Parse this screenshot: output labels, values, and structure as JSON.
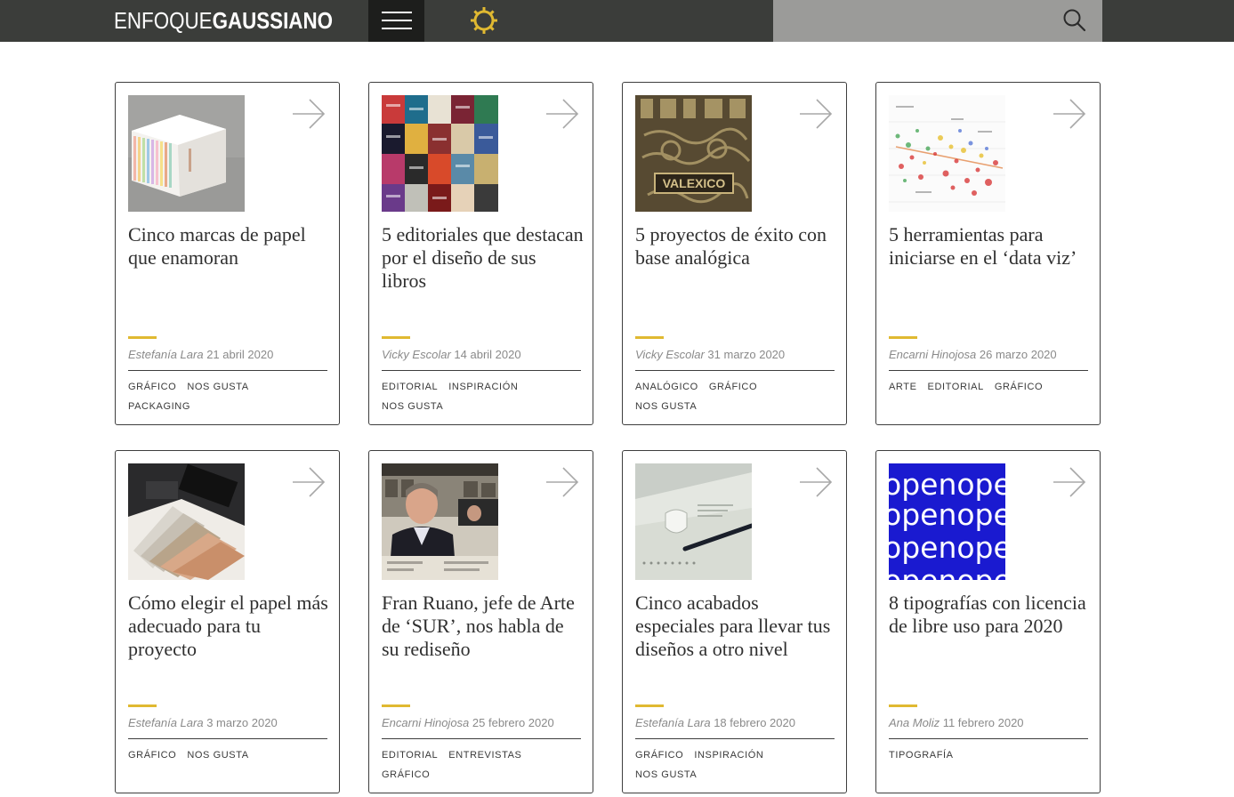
{
  "header": {
    "logo_light": "ENFOQUE",
    "logo_bold": "GAUSSIANO",
    "search_placeholder": "",
    "colors": {
      "bar": "#3b3d3a",
      "menu": "#1d1e1c",
      "search": "#9b9b99",
      "accent": "#e0b931"
    },
    "icons": [
      "menu-icon",
      "sun-icon",
      "search-icon"
    ]
  },
  "articles": [
    {
      "title": "Cinco marcas de papel que enamoran",
      "author": "Estefanía Lara",
      "date": "21 abril 2020",
      "tags": [
        "GRÁFICO",
        "NOS GUSTA",
        "PACKAGING"
      ]
    },
    {
      "title": "5 editoriales que destacan por el diseño de sus libros",
      "author": "Vicky Escolar",
      "date": "14 abril 2020",
      "tags": [
        "EDITORIAL",
        "INSPIRACIÓN",
        "NOS GUSTA"
      ]
    },
    {
      "title": "5 proyectos de éxito con base analógica",
      "author": "Vicky Escolar",
      "date": "31 marzo 2020",
      "tags": [
        "ANALÓGICO",
        "GRÁFICO",
        "NOS GUSTA"
      ]
    },
    {
      "title": "5 herramientas para iniciarse en el ‘data viz’",
      "author": "Encarni Hinojosa",
      "date": "26 marzo 2020",
      "tags": [
        "ARTE",
        "EDITORIAL",
        "GRÁFICO"
      ]
    },
    {
      "title": "Cómo elegir el papel más adecuado para tu proyecto",
      "author": "Estefanía Lara",
      "date": "3 marzo 2020",
      "tags": [
        "GRÁFICO",
        "NOS GUSTA"
      ]
    },
    {
      "title": "Fran Ruano, jefe de Arte de ‘SUR’, nos habla de su rediseño",
      "author": "Encarni Hinojosa",
      "date": "25 febrero 2020",
      "tags": [
        "EDITORIAL",
        "ENTREVISTAS",
        "GRÁFICO"
      ]
    },
    {
      "title": "Cinco acabados especiales para llevar tus diseños a otro nivel",
      "author": "Estefanía Lara",
      "date": "18 febrero 2020",
      "tags": [
        "GRÁFICO",
        "INSPIRACIÓN",
        "NOS GUSTA"
      ]
    },
    {
      "title": "8 tipografías con licencia de libre uso para 2020",
      "author": "Ana Moliz",
      "date": "11 febrero 2020",
      "tags": [
        "TIPOGRAFÍA"
      ]
    }
  ],
  "thumb_text": {
    "card3_stamp": "VALEXICO",
    "card8_word": "openope"
  }
}
